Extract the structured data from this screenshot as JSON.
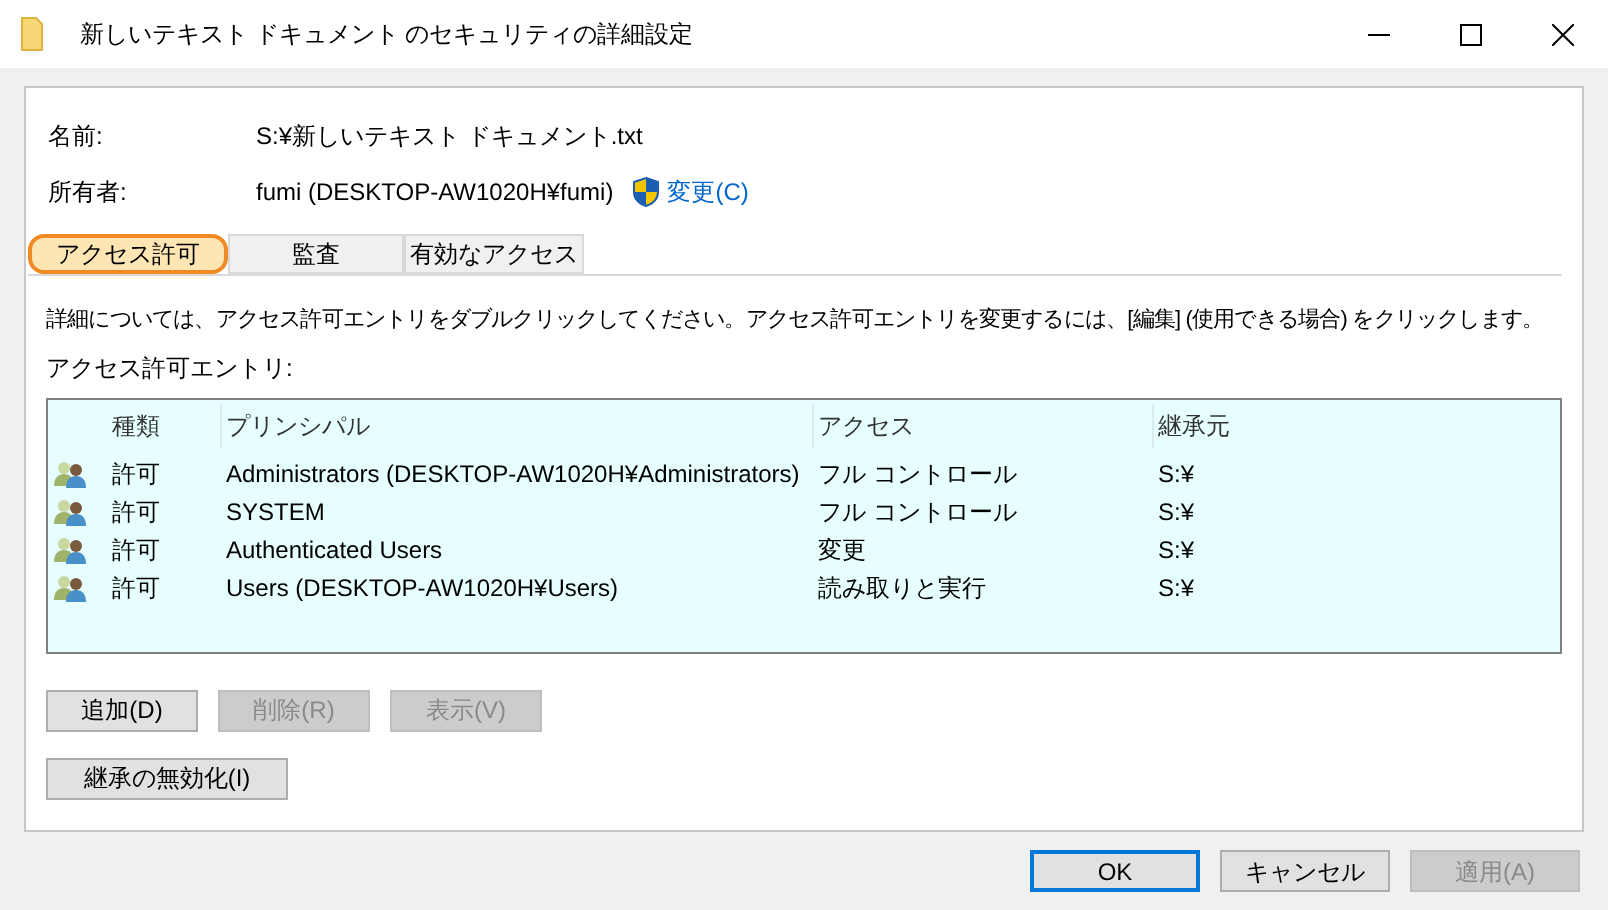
{
  "window": {
    "title": "新しいテキスト ドキュメント のセキュリティの詳細設定"
  },
  "fields": [
    {
      "label": "名前:",
      "value": "S:¥新しいテキスト ドキュメント.txt"
    },
    {
      "label": "所有者:",
      "value": "fumi (DESKTOP-AW1020H¥fumi)",
      "link": "変更(C)"
    }
  ],
  "tabs": [
    {
      "label": "アクセス許可",
      "selected": true
    },
    {
      "label": "監査",
      "selected": false
    },
    {
      "label": "有効なアクセス",
      "selected": false
    }
  ],
  "description": "詳細については、アクセス許可エントリをダブルクリックしてください。アクセス許可エントリを変更するには、[編集] (使用できる場合) をクリックします。",
  "list_label": "アクセス許可エントリ:",
  "table": {
    "columns": [
      "種類",
      "プリンシパル",
      "アクセス",
      "継承元"
    ],
    "rows": [
      [
        "許可",
        "Administrators (DESKTOP-AW1020H¥Administrators)",
        "フル コントロール",
        "S:¥"
      ],
      [
        "許可",
        "SYSTEM",
        "フル コントロール",
        "S:¥"
      ],
      [
        "許可",
        "Authenticated Users",
        "変更",
        "S:¥"
      ],
      [
        "許可",
        "Users (DESKTOP-AW1020H¥Users)",
        "読み取りと実行",
        "S:¥"
      ]
    ]
  },
  "entry_buttons": [
    {
      "label": "追加(D)",
      "disabled": false
    },
    {
      "label": "削除(R)",
      "disabled": true
    },
    {
      "label": "表示(V)",
      "disabled": true
    }
  ],
  "inheritance_button": {
    "label": "継承の無効化(I)"
  },
  "dialog_buttons": [
    {
      "label": "OK",
      "default": true,
      "disabled": false
    },
    {
      "label": "キャンセル",
      "default": false,
      "disabled": false
    },
    {
      "label": "適用(A)",
      "default": false,
      "disabled": true
    }
  ]
}
